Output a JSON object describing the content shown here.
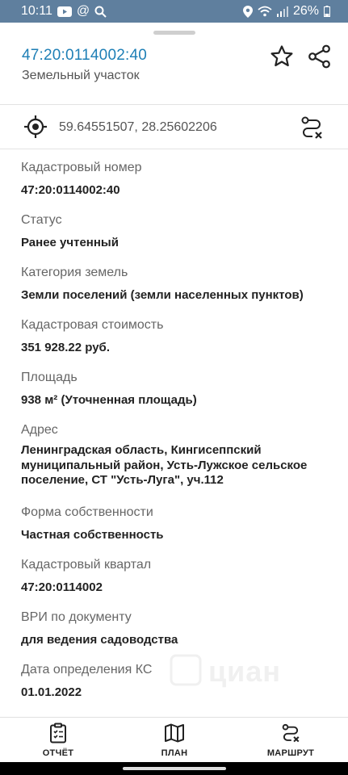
{
  "status_bar": {
    "time": "10:11",
    "battery": "26%"
  },
  "header": {
    "cadastral_id": "47:20:0114002:40",
    "object_type": "Земельный участок"
  },
  "coordinates": {
    "text": "59.64551507, 28.25602206"
  },
  "fields": [
    {
      "label": "Кадастровый номер",
      "value": "47:20:0114002:40"
    },
    {
      "label": "Статус",
      "value": "Ранее учтенный"
    },
    {
      "label": "Категория земель",
      "value": "Земли поселений (земли населенных пунктов)"
    },
    {
      "label": "Кадастровая стоимость",
      "value": "351 928.22 руб."
    },
    {
      "label": "Площадь",
      "value": "938 м² (Уточненная площадь)"
    },
    {
      "label": "Адрес",
      "value_lines": [
        "Ленинградская область, Кингисеппский",
        "муниципальный район, Усть-Лужское сельское",
        "поселение, СТ \"Усть-Луга\", уч.112"
      ]
    },
    {
      "label": "Форма собственности",
      "value": "Частная собственность"
    },
    {
      "label": "Кадастровый квартал",
      "value": "47:20:0114002"
    },
    {
      "label": "ВРИ по документу",
      "value": "для ведения садоводства"
    },
    {
      "label": "Дата определения КС",
      "value": "01.01.2022"
    }
  ],
  "watermark": "циан",
  "bottom_nav": [
    {
      "label": "ОТЧЁТ",
      "icon": "report-icon"
    },
    {
      "label": "ПЛАН",
      "icon": "map-icon"
    },
    {
      "label": "МАРШРУТ",
      "icon": "route-icon"
    }
  ],
  "colors": {
    "status_bar": "#5f7f9e",
    "accent": "#1e7fb6"
  }
}
